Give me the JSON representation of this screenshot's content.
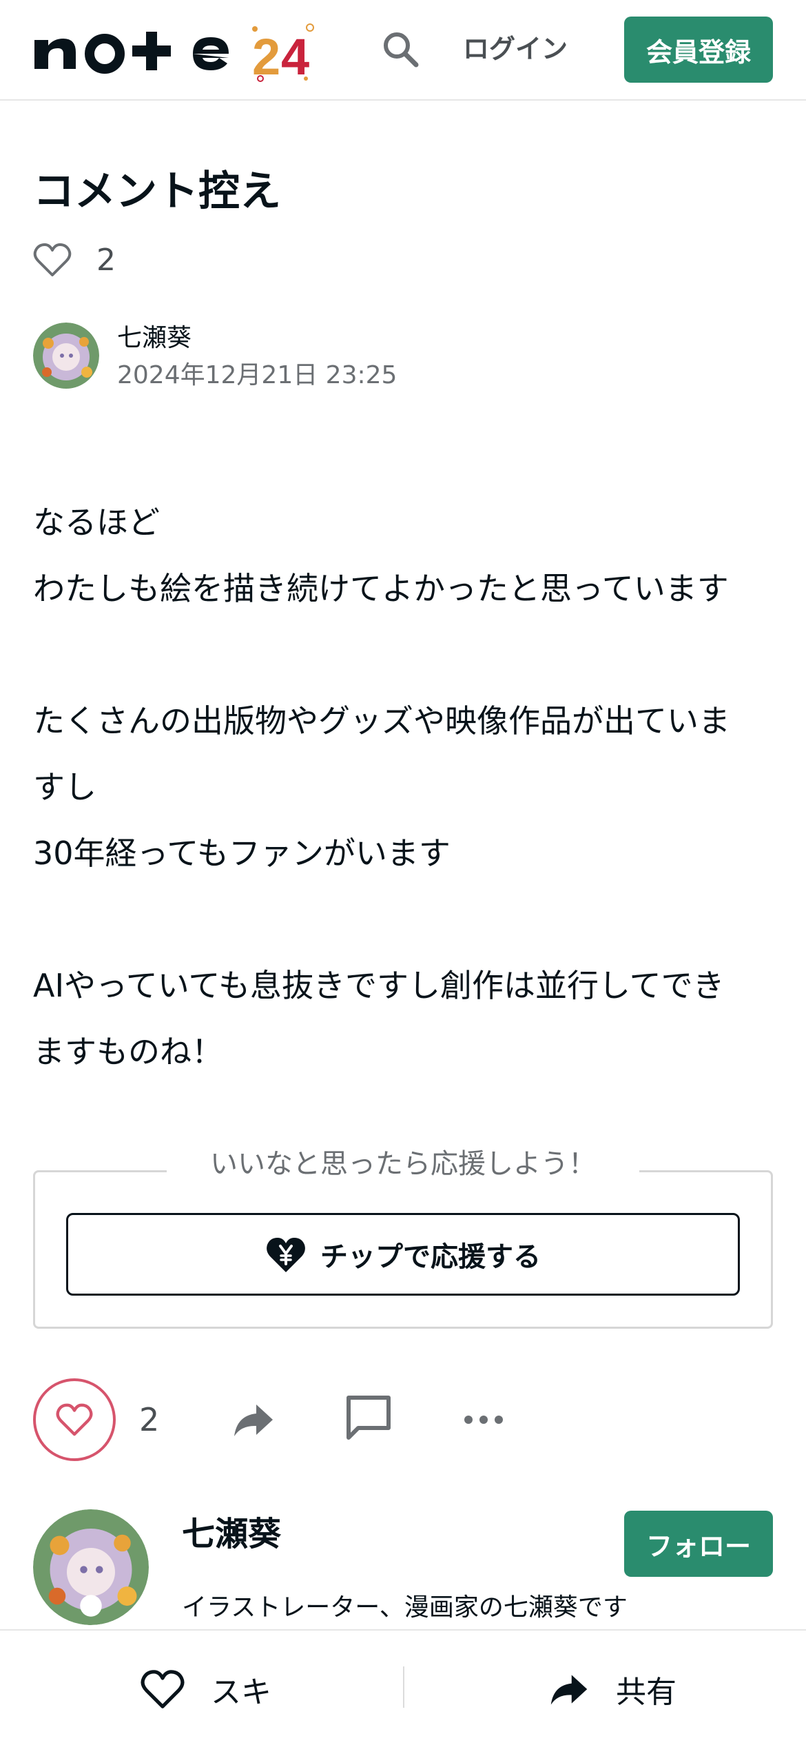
{
  "header": {
    "logo_text": "note",
    "login_label": "ログイン",
    "signup_label": "会員登録"
  },
  "article": {
    "title": "コメント控え",
    "like_count": "2",
    "author_name": "七瀬葵",
    "date": "2024年12月21日 23:25",
    "body": [
      "なるほど",
      "わたしも絵を描き続けてよかったと思っています",
      "",
      "たくさんの出版物やグッズや映像作品が出ていま",
      "すし",
      "30年経ってもファンがいます",
      "",
      "AIやっていても息抜きですし創作は並行してでき",
      "ますものね！"
    ]
  },
  "tip": {
    "caption": "いいなと思ったら応援しよう！",
    "button_label": "チップで応援する"
  },
  "actions": {
    "like_count": "2"
  },
  "creator": {
    "name": "七瀬葵",
    "bio": "イラストレーター、漫画家の七瀬葵です",
    "follow_label": "フォロー"
  },
  "bottom_bar": {
    "like_label": "スキ",
    "share_label": "共有"
  },
  "colors": {
    "brand_green": "#2a8c6e",
    "like_pink": "#d6546c",
    "text": "#08131a"
  }
}
